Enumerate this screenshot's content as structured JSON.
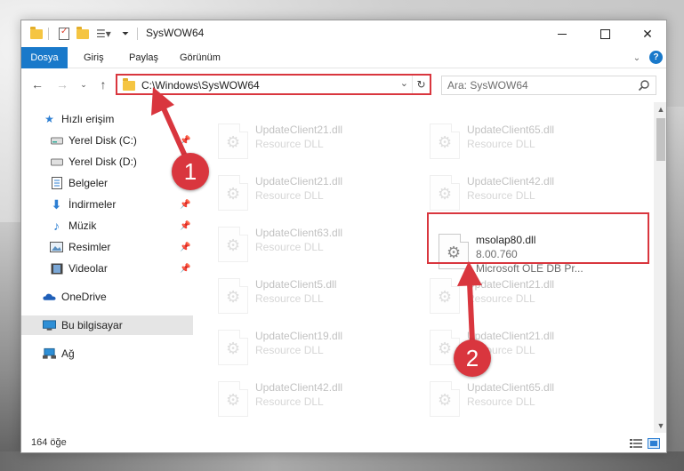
{
  "window": {
    "title": "SysWOW64"
  },
  "ribbon": {
    "tabs": [
      "Dosya",
      "Giriş",
      "Paylaş",
      "Görünüm"
    ]
  },
  "nav": {
    "address": "C:\\Windows\\SysWOW64",
    "search_placeholder": "Ara: SysWOW64"
  },
  "sidebar": {
    "items": [
      {
        "label": "Hızlı erişim",
        "icon": "star-icon"
      },
      {
        "label": "Yerel Disk (C:)",
        "icon": "drive-icon"
      },
      {
        "label": "Yerel Disk (D:)",
        "icon": "drive-icon"
      },
      {
        "label": "Belgeler",
        "icon": "documents-icon"
      },
      {
        "label": "İndirmeler",
        "icon": "download-arrow-icon"
      },
      {
        "label": "Müzik",
        "icon": "music-note-icon"
      },
      {
        "label": "Resimler",
        "icon": "pictures-icon"
      },
      {
        "label": "Videolar",
        "icon": "film-icon"
      },
      {
        "label": "OneDrive",
        "icon": "cloud-icon"
      },
      {
        "label": "Bu bilgisayar",
        "icon": "computer-icon"
      },
      {
        "label": "Ağ",
        "icon": "network-icon"
      }
    ]
  },
  "files": [
    {
      "name": "UpdateClient21.dll",
      "sub1": "Resource DLL",
      "sub2": ""
    },
    {
      "name": "UpdateClient65.dll",
      "sub1": "Resource DLL",
      "sub2": ""
    },
    {
      "name": "UpdateClient21.dll",
      "sub1": "Resource DLL",
      "sub2": ""
    },
    {
      "name": "UpdateClient42.dll",
      "sub1": "Resource DLL",
      "sub2": ""
    },
    {
      "name": "UpdateClient63.dll",
      "sub1": "Resource DLL",
      "sub2": ""
    },
    {
      "name": "msolap80.dll",
      "sub1": "8.00.760",
      "sub2": "Microsoft OLE DB Pr..."
    },
    {
      "name": "UpdateClient5.dll",
      "sub1": "Resource DLL",
      "sub2": ""
    },
    {
      "name": "UpdateClient21.dll",
      "sub1": "Resource DLL",
      "sub2": ""
    },
    {
      "name": "UpdateClient19.dll",
      "sub1": "Resource DLL",
      "sub2": ""
    },
    {
      "name": "UpdateClient21.dll",
      "sub1": "Resource DLL",
      "sub2": ""
    },
    {
      "name": "UpdateClient42.dll",
      "sub1": "Resource DLL",
      "sub2": ""
    },
    {
      "name": "UpdateClient65.dll",
      "sub1": "Resource DLL",
      "sub2": ""
    }
  ],
  "status": {
    "item_count": "164 öğe"
  },
  "annotations": {
    "step1": "1",
    "step2": "2",
    "color": "#d9363e"
  },
  "colors": {
    "accent": "#1979ca",
    "highlight": "#d9363e",
    "selected_nav": "#e5e5e5"
  }
}
